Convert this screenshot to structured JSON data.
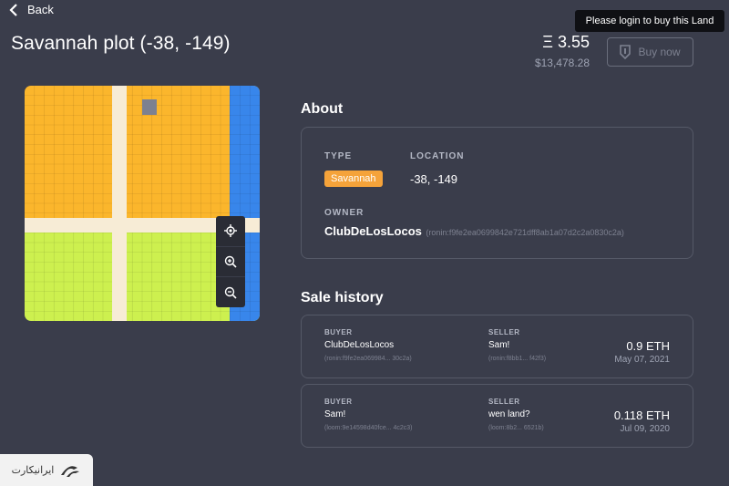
{
  "nav": {
    "back_label": "Back"
  },
  "header": {
    "title": "Savannah plot (-38, -149)",
    "price_eth": "Ξ 3.55",
    "price_usd": "$13,478.28",
    "buy_label": "Buy now",
    "tooltip": "Please login to buy this Land"
  },
  "about": {
    "heading": "About",
    "type_label": "TYPE",
    "type_value": "Savannah",
    "location_label": "LOCATION",
    "location_value": "-38, -149",
    "owner_label": "OWNER",
    "owner_name": "ClubDeLosLocos",
    "owner_address": "(ronin:f9fe2ea0699842e721dff8ab1a07d2c2a0830c2a)"
  },
  "sale_history": {
    "heading": "Sale history",
    "buyer_label": "BUYER",
    "seller_label": "SELLER",
    "sales": [
      {
        "buyer": "ClubDeLosLocos",
        "buyer_addr": "(ronin:f9fe2ea069984... 30c2a)",
        "seller": "Sam!",
        "seller_addr": "(ronin:f8bb1... f42f3)",
        "price": "0.9 ETH",
        "date": "May 07, 2021"
      },
      {
        "buyer": "Sam!",
        "buyer_addr": "(loom:9e14598d40fce... 4c2c3)",
        "seller": "wen land?",
        "seller_addr": "(loom:8b2... 6521b)",
        "price": "0.118 ETH",
        "date": "Jul 09, 2020"
      }
    ]
  },
  "map": {
    "colors": {
      "savannah": "#fbb62c",
      "forest": "#cdf04f",
      "road": "#f7ecd6",
      "water": "#3886eb",
      "selected": "#7d8190"
    },
    "icons": [
      "locate-icon",
      "zoom-in-icon",
      "zoom-out-icon"
    ]
  },
  "watermark": {
    "text": "ایرانیکارت"
  }
}
